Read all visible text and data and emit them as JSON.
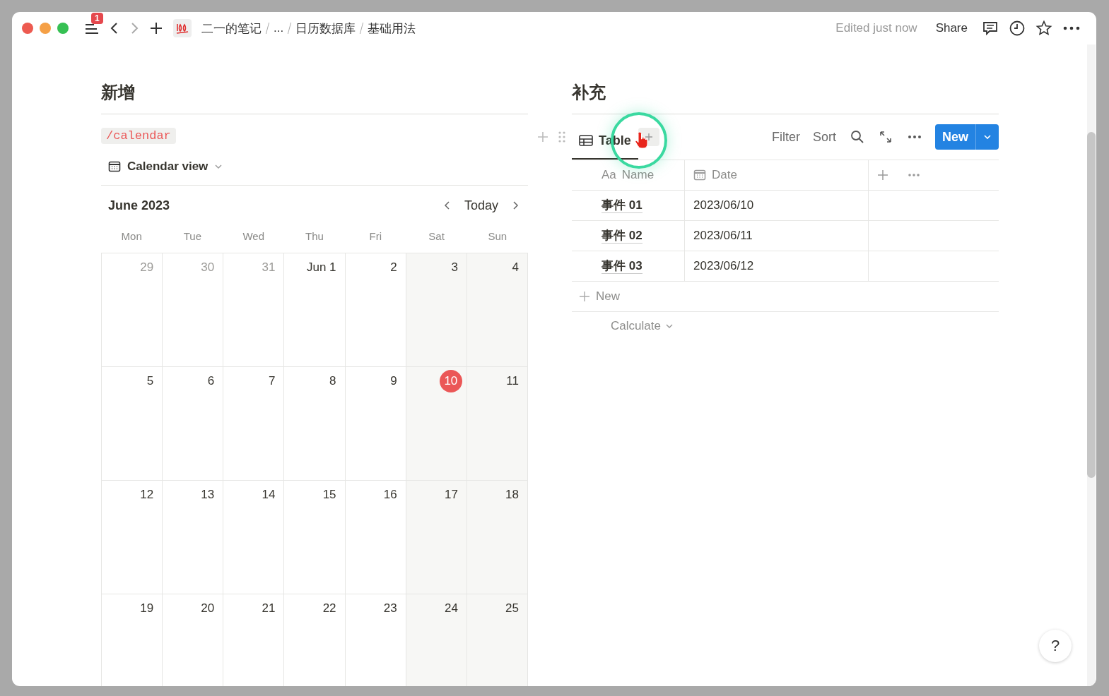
{
  "topbar": {
    "badge": "1",
    "breadcrumbs": [
      {
        "text": "二一的笔记"
      },
      {
        "text": "..."
      },
      {
        "text": "日历数据库"
      },
      {
        "text": "基础用法"
      }
    ],
    "edited": "Edited just now",
    "share": "Share"
  },
  "left": {
    "heading": "新增",
    "code": "/calendar",
    "view": "Calendar view",
    "month": "June 2023",
    "today_button": "Today",
    "weekdays": [
      "Mon",
      "Tue",
      "Wed",
      "Thu",
      "Fri",
      "Sat",
      "Sun"
    ],
    "days": [
      {
        "label": "29",
        "muted": true,
        "today": false
      },
      {
        "label": "30",
        "muted": true,
        "today": false
      },
      {
        "label": "31",
        "muted": true,
        "today": false
      },
      {
        "label": "Jun 1",
        "muted": false,
        "today": false
      },
      {
        "label": "2",
        "muted": false,
        "today": false
      },
      {
        "label": "3",
        "muted": false,
        "today": false
      },
      {
        "label": "4",
        "muted": false,
        "today": false
      },
      {
        "label": "5",
        "muted": false,
        "today": false
      },
      {
        "label": "6",
        "muted": false,
        "today": false
      },
      {
        "label": "7",
        "muted": false,
        "today": false
      },
      {
        "label": "8",
        "muted": false,
        "today": false
      },
      {
        "label": "9",
        "muted": false,
        "today": false
      },
      {
        "label": "10",
        "muted": false,
        "today": true
      },
      {
        "label": "11",
        "muted": false,
        "today": false
      },
      {
        "label": "12",
        "muted": false,
        "today": false
      },
      {
        "label": "13",
        "muted": false,
        "today": false
      },
      {
        "label": "14",
        "muted": false,
        "today": false
      },
      {
        "label": "15",
        "muted": false,
        "today": false
      },
      {
        "label": "16",
        "muted": false,
        "today": false
      },
      {
        "label": "17",
        "muted": false,
        "today": false
      },
      {
        "label": "18",
        "muted": false,
        "today": false
      },
      {
        "label": "19",
        "muted": false,
        "today": false
      },
      {
        "label": "20",
        "muted": false,
        "today": false
      },
      {
        "label": "21",
        "muted": false,
        "today": false
      },
      {
        "label": "22",
        "muted": false,
        "today": false
      },
      {
        "label": "23",
        "muted": false,
        "today": false
      },
      {
        "label": "24",
        "muted": false,
        "today": false
      },
      {
        "label": "25",
        "muted": false,
        "today": false
      }
    ]
  },
  "right": {
    "heading": "补充",
    "tabs": [
      {
        "label": "Table",
        "selected": true
      }
    ],
    "filter": "Filter",
    "sort": "Sort",
    "new_button": "New",
    "columns": [
      {
        "kind": "title",
        "prefix": "Aa",
        "label": "Name"
      },
      {
        "kind": "date",
        "label": "Date"
      }
    ],
    "rows": [
      {
        "name": "事件 01",
        "date": "2023/06/10"
      },
      {
        "name": "事件 02",
        "date": "2023/06/11"
      },
      {
        "name": "事件 03",
        "date": "2023/06/12"
      }
    ],
    "add_row": "New",
    "calculate": "Calculate"
  },
  "help": "?"
}
